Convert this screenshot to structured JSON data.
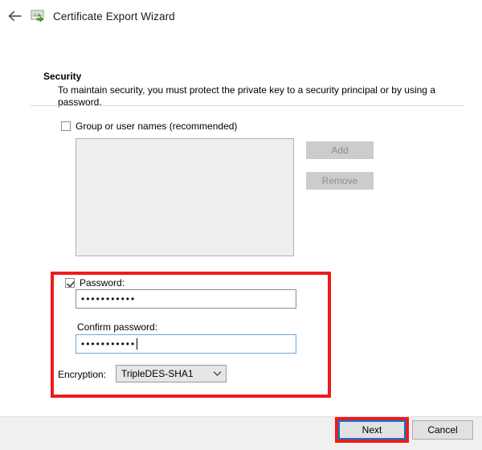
{
  "window": {
    "title": "Certificate Export Wizard",
    "back_icon": "back-arrow-icon",
    "app_icon": "certificate-export-icon"
  },
  "section": {
    "heading": "Security",
    "description": "To maintain security, you must protect the private key to a security principal or by using a password."
  },
  "groups": {
    "checkbox_label": "Group or user names (recommended)",
    "checked": false,
    "add_label": "Add",
    "remove_label": "Remove",
    "add_enabled": false,
    "remove_enabled": false,
    "list_items": []
  },
  "password": {
    "checkbox_label": "Password:",
    "checked": true,
    "value": "•••••••••••",
    "confirm_label": "Confirm password:",
    "confirm_value": "•••••••••••"
  },
  "encryption": {
    "label": "Encryption:",
    "selected": "TripleDES-SHA1",
    "arrow_icon": "chevron-down-icon"
  },
  "footer": {
    "next_label": "Next",
    "cancel_label": "Cancel"
  },
  "annotations": {
    "highlight_color": "#ee1b1b",
    "focus_color": "#0078d7"
  }
}
